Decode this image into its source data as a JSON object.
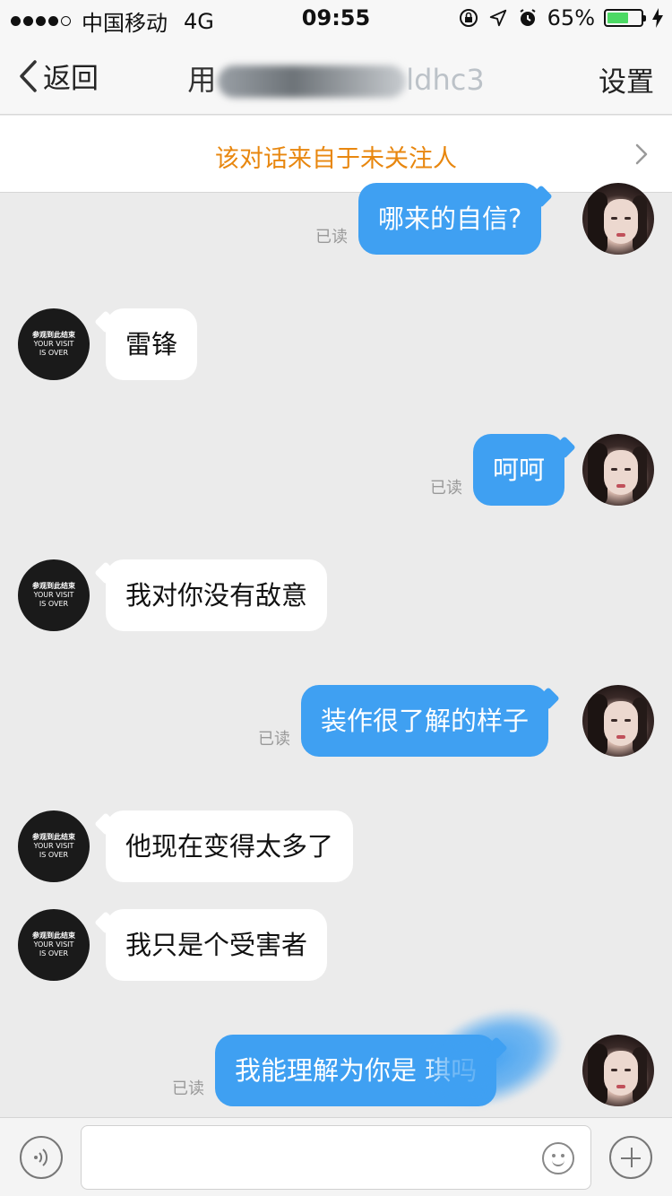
{
  "status_bar": {
    "carrier": "中国移动",
    "network": "4G",
    "time": "09:55",
    "battery_percent_label": "65%",
    "battery_level": 0.65,
    "icons": [
      "signal-dots",
      "orientation-lock-icon",
      "location-arrow-icon",
      "alarm-icon",
      "battery-icon",
      "charging-bolt-icon"
    ]
  },
  "nav": {
    "back_label": "返回",
    "title_visible_prefix": "用",
    "title_visible_suffix": "ldhc3",
    "settings_label": "设置"
  },
  "banner": {
    "text": "该对话来自于未关注人",
    "accent_color": "#e8870f"
  },
  "messages": [
    {
      "sender": "me",
      "text": "哪来的自信?",
      "read_label": "已读"
    },
    {
      "sender": "other",
      "text": "雷锋"
    },
    {
      "sender": "me",
      "text": "呵呵",
      "read_label": "已读"
    },
    {
      "sender": "other",
      "text": "我对你没有敌意"
    },
    {
      "sender": "me",
      "text": "装作很了解的样子",
      "read_label": "已读"
    },
    {
      "sender": "other",
      "text": "他现在变得太多了"
    },
    {
      "sender": "other",
      "text": "我只是个受害者"
    },
    {
      "sender": "me",
      "text": "我能理解为你是 琪吗",
      "read_label": "已读"
    }
  ],
  "other_avatar": {
    "line1": "参观到此结束",
    "line2": "YOUR VISIT",
    "line3": "IS OVER"
  },
  "input_bar": {
    "value": "",
    "placeholder": ""
  },
  "colors": {
    "my_bubble": "#3fa0f2",
    "other_bubble": "#ffffff",
    "chat_background": "#ebebeb"
  }
}
